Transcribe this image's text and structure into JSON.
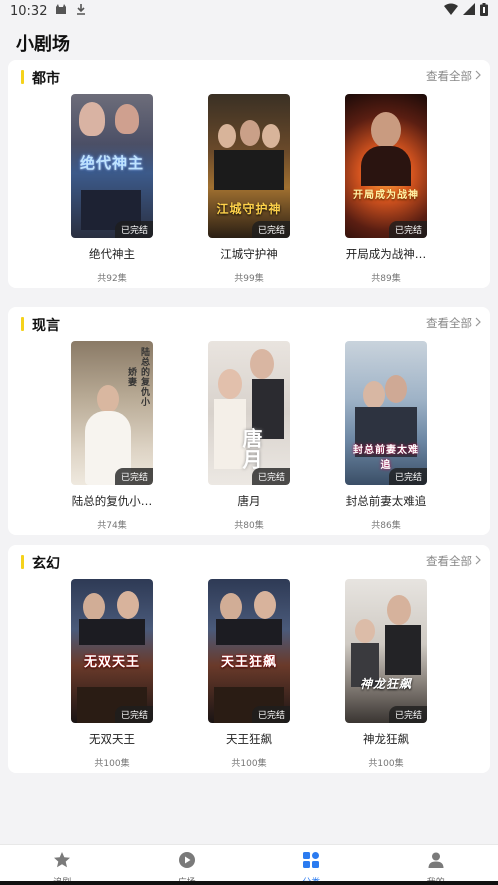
{
  "status": {
    "time": "10:32"
  },
  "page": {
    "title": "小剧场"
  },
  "sections": [
    {
      "title": "都市",
      "see_all": "查看全部",
      "items": [
        {
          "title": "绝代神主",
          "episodes": "共92集",
          "status": "已完结",
          "poster_text": "绝代神主"
        },
        {
          "title": "江城守护神",
          "episodes": "共99集",
          "status": "已完结",
          "poster_text": "江城守护神"
        },
        {
          "title": "开局成为战神…",
          "episodes": "共89集",
          "status": "已完结",
          "poster_text": "开局成为战神"
        }
      ]
    },
    {
      "title": "现言",
      "see_all": "查看全部",
      "items": [
        {
          "title": "陆总的复仇小…",
          "episodes": "共74集",
          "status": "已完结",
          "poster_text": "陆总的复仇小娇妻"
        },
        {
          "title": "唐月",
          "episodes": "共80集",
          "status": "已完结",
          "poster_text": "唐月"
        },
        {
          "title": "封总前妻太难追",
          "episodes": "共86集",
          "status": "已完结",
          "poster_text": "封总前妻太难追"
        }
      ]
    },
    {
      "title": "玄幻",
      "see_all": "查看全部",
      "items": [
        {
          "title": "无双天王",
          "episodes": "共100集",
          "status": "已完结",
          "poster_text": "无双天王"
        },
        {
          "title": "天王狂飙",
          "episodes": "共100集",
          "status": "已完结",
          "poster_text": "天王狂飙"
        },
        {
          "title": "神龙狂飙",
          "episodes": "共100集",
          "status": "已完结",
          "poster_text": "神龙狂飙"
        }
      ]
    }
  ],
  "tabs": [
    {
      "label": "追剧",
      "icon": "star-icon"
    },
    {
      "label": "广场",
      "icon": "play-icon"
    },
    {
      "label": "分类",
      "icon": "category-icon",
      "active": true
    },
    {
      "label": "我的",
      "icon": "profile-icon"
    }
  ],
  "colors": {
    "accent": "#f5d21b",
    "active_tab": "#2b7bf0"
  }
}
